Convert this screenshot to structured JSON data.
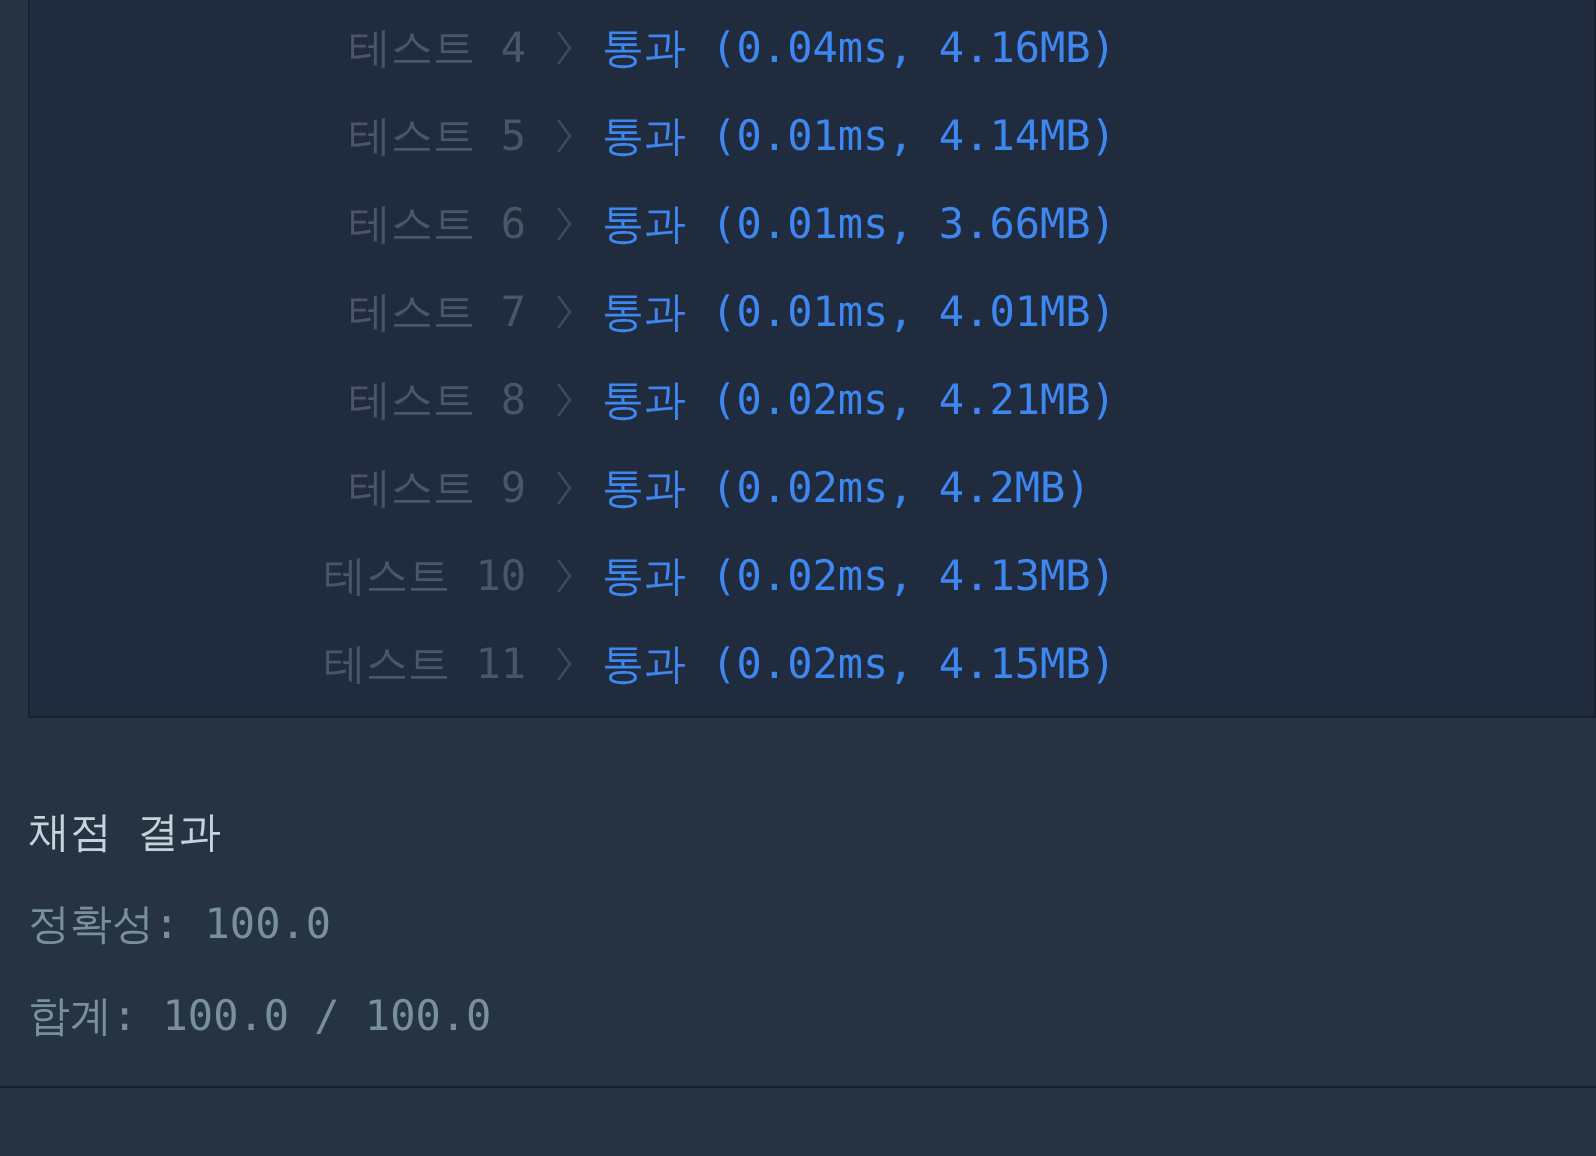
{
  "tests": [
    {
      "label": "테스트 4",
      "result": "통과 (0.04ms, 4.16MB)"
    },
    {
      "label": "테스트 5",
      "result": "통과 (0.01ms, 4.14MB)"
    },
    {
      "label": "테스트 6",
      "result": "통과 (0.01ms, 3.66MB)"
    },
    {
      "label": "테스트 7",
      "result": "통과 (0.01ms, 4.01MB)"
    },
    {
      "label": "테스트 8",
      "result": "통과 (0.02ms, 4.21MB)"
    },
    {
      "label": "테스트 9",
      "result": "통과 (0.02ms, 4.2MB)"
    },
    {
      "label": "테스트 10",
      "result": "통과 (0.02ms, 4.13MB)"
    },
    {
      "label": "테스트 11",
      "result": "통과 (0.02ms, 4.15MB)"
    }
  ],
  "grading": {
    "title": "채점 결과",
    "lines": [
      "정확성: 100.0",
      "합계: 100.0 / 100.0"
    ]
  }
}
